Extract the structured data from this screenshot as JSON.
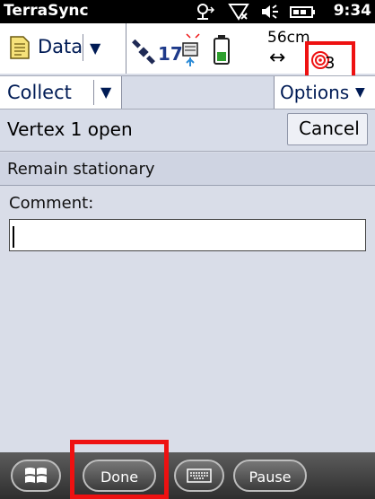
{
  "titlebar": {
    "app_title": "TerraSync",
    "clock": "9:34",
    "icons": [
      "network-signal-icon",
      "no-signal-icon",
      "speaker-icon",
      "battery-icon"
    ]
  },
  "status": {
    "data_label": "Data",
    "satellite_count": "17",
    "distance": "56cm",
    "target_count": "3"
  },
  "collect_bar": {
    "collect_label": "Collect",
    "options_label": "Options"
  },
  "vertex_bar": {
    "vertex_text": "Vertex 1 open",
    "cancel_label": "Cancel"
  },
  "status_message": "Remain stationary",
  "comment": {
    "label": "Comment:",
    "value": ""
  },
  "bottom_bar": {
    "done_label": "Done",
    "pause_label": "Pause"
  },
  "colors": {
    "highlight": "#ee1111",
    "accent": "#001b55"
  }
}
